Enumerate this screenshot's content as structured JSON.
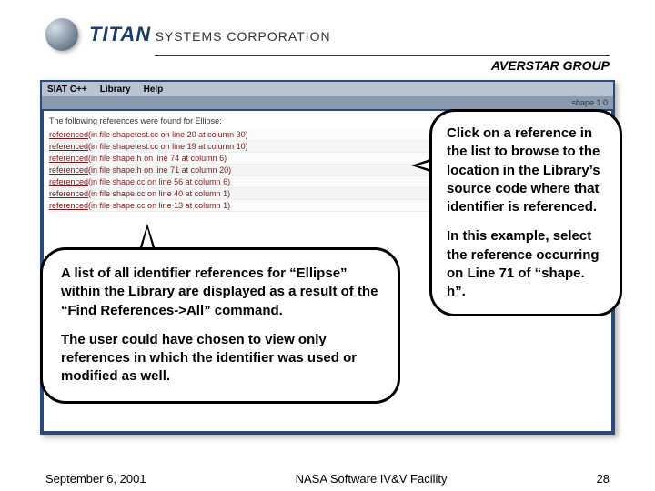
{
  "logo": {
    "titan": "TITAN",
    "systems": "SYSTEMS CORPORATION"
  },
  "averstar": "AVERSTAR GROUP",
  "menubar": {
    "siat": "SIAT C++",
    "library": "Library",
    "help": "Help"
  },
  "url_hint": "shape 1 0",
  "refs": {
    "heading": "The following references were found for Ellipse:",
    "items": [
      {
        "link": "referenced",
        "rest": "(in file shapetest.cc on line 20 at column 30)"
      },
      {
        "link": "referenced",
        "rest": "(in file shapetest.cc on line 19 at column 10)"
      },
      {
        "link": "referenced",
        "rest": "(in file shape.h on line 74 at column 6)"
      },
      {
        "link": "referenced",
        "rest": "(in file shape.h on line 71 at column 20)"
      },
      {
        "link": "referenced",
        "rest": "(in file shape.cc on line 56 at column 6)"
      },
      {
        "link": "referenced",
        "rest": "(in file shape.cc on line 40 at column 1)"
      },
      {
        "link": "referenced",
        "rest": "(in file shape.cc on line 13 at column 1)"
      }
    ]
  },
  "callout_left": {
    "p1": "A list of all identifier references for “Ellipse” within the Library are displayed as a result of the “Find References->All” command.",
    "p2": "The user could have chosen to view only references in which the identifier was used or modified as well."
  },
  "callout_right": {
    "p1": "Click on a reference in the list to browse to the location in the Library’s source code where that identifier is referenced.",
    "p2": "In this example, select the reference occurring on Line 71 of “shape. h”."
  },
  "footer": {
    "date": "September 6, 2001",
    "center": "NASA Software IV&V Facility",
    "page": "28"
  }
}
